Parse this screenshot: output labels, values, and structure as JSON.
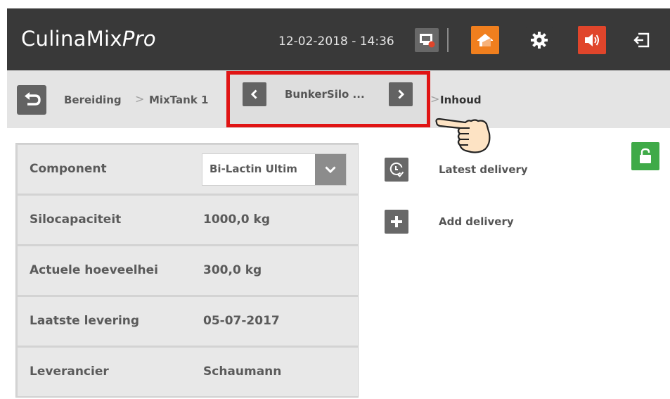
{
  "header": {
    "app_name": "CulinaMix",
    "app_name_suffix": "Pro",
    "datetime": "12-02-2018 - 14:36",
    "icons": [
      "screen-warning-icon",
      "home-icon",
      "gear-icon",
      "speaker-icon",
      "logout-icon"
    ]
  },
  "breadcrumb": {
    "items": [
      "Bereiding",
      "MixTank 1"
    ],
    "separator": ">",
    "selector_label": "BunkerSilo ...",
    "current": "Inhoud"
  },
  "properties": [
    {
      "label": "Component",
      "value": "Bi-Lactin Ultim"
    },
    {
      "label": "Silocapaciteit",
      "value": "1000,0 kg"
    },
    {
      "label": "Actuele hoeveelhei",
      "value": "300,0 kg"
    },
    {
      "label": "Laatste levering",
      "value": "05-07-2017"
    },
    {
      "label": "Leverancier",
      "value": "Schaumann"
    }
  ],
  "actions": [
    {
      "label": "Latest delivery",
      "icon": "clock-check-icon"
    },
    {
      "label": "Add delivery",
      "icon": "plus-icon"
    }
  ],
  "colors": {
    "topbar": "#393939",
    "home_accent": "#f07f1e",
    "sound_accent": "#e0452b",
    "lock_accent": "#3faa48",
    "highlight_frame": "#e01414"
  }
}
